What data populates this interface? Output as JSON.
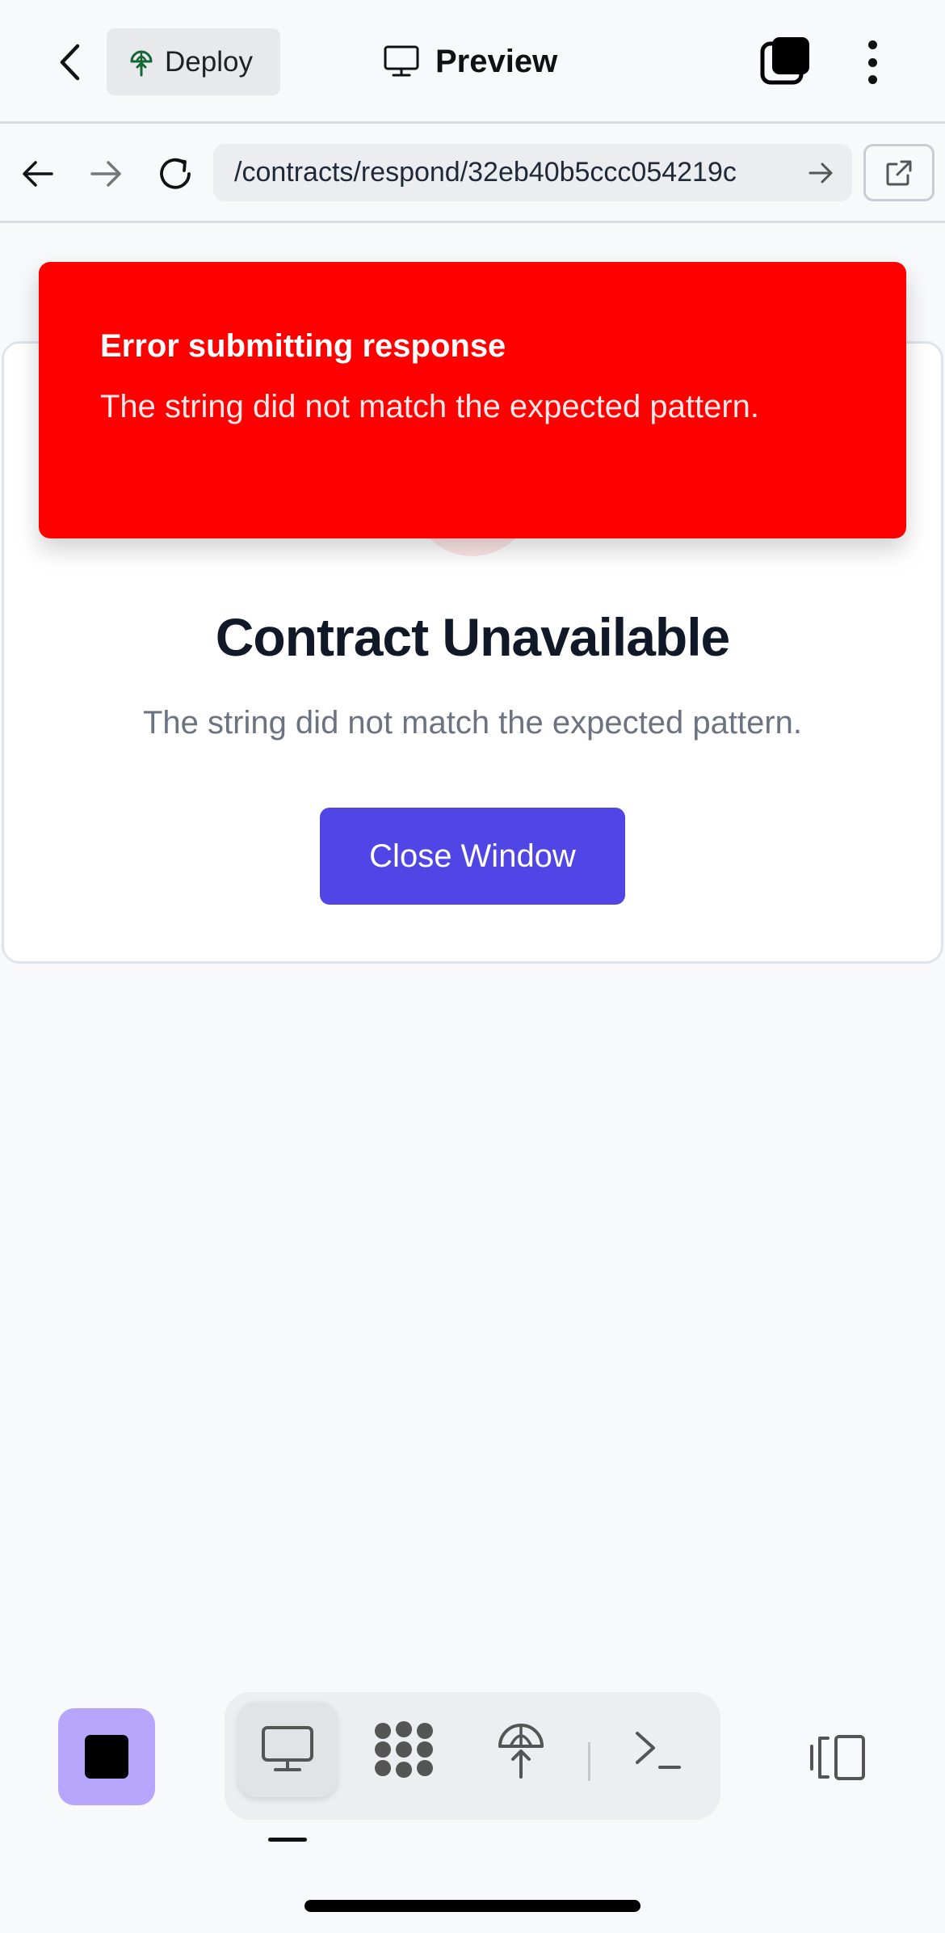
{
  "header": {
    "deploy_label": "Deploy",
    "title": "Preview"
  },
  "browser": {
    "url": "/contracts/respond/32eb40b5ccc054219c"
  },
  "toast": {
    "title": "Error submitting response",
    "message": "The string did not match the expected pattern.",
    "color": "#ff0000"
  },
  "card": {
    "title": "Contract Unavailable",
    "message": "The string did not match the expected pattern.",
    "button_label": "Close Window"
  },
  "colors": {
    "accent": "#4f46e5",
    "stop_button": "#b7a4fb"
  },
  "dock": {
    "items": [
      "monitor-icon",
      "workflow-icon",
      "deploy-icon",
      "terminal-icon"
    ],
    "active": "monitor-icon"
  }
}
